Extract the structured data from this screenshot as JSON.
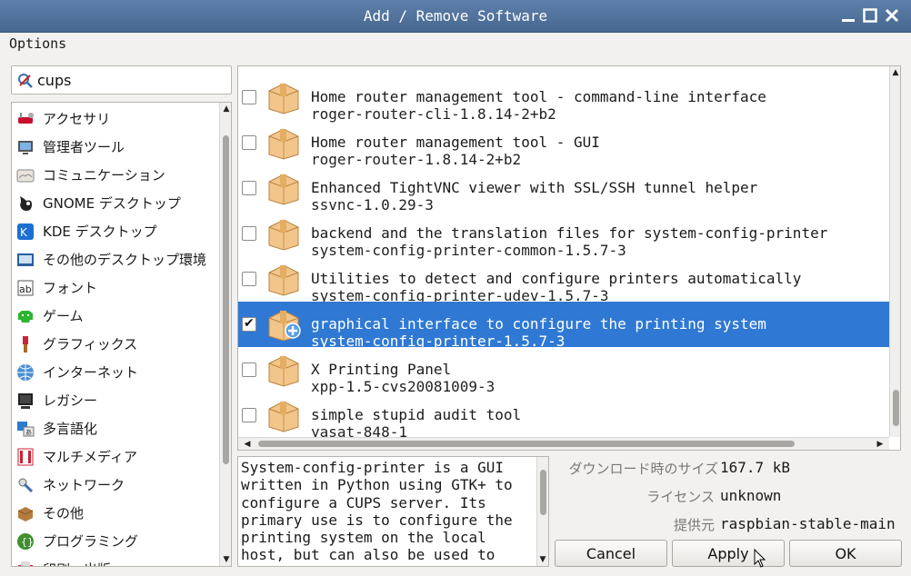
{
  "window": {
    "title": "Add / Remove Software"
  },
  "menu": {
    "options": "Options"
  },
  "search": {
    "value": "cups",
    "icon": "clear-search-icon"
  },
  "categories": [
    {
      "label": "アクセサリ",
      "icon": "accessories-icon"
    },
    {
      "label": "管理者ツール",
      "icon": "admin-tools-icon"
    },
    {
      "label": "コミュニケーション",
      "icon": "communication-icon"
    },
    {
      "label": "GNOME デスクトップ",
      "icon": "gnome-icon"
    },
    {
      "label": "KDE デスクトップ",
      "icon": "kde-icon"
    },
    {
      "label": "その他のデスクトップ環境",
      "icon": "other-desktop-icon"
    },
    {
      "label": "フォント",
      "icon": "font-icon"
    },
    {
      "label": "ゲーム",
      "icon": "game-icon"
    },
    {
      "label": "グラフィックス",
      "icon": "graphics-icon"
    },
    {
      "label": "インターネット",
      "icon": "internet-icon"
    },
    {
      "label": "レガシー",
      "icon": "legacy-icon"
    },
    {
      "label": "多言語化",
      "icon": "localization-icon"
    },
    {
      "label": "マルチメディア",
      "icon": "multimedia-icon"
    },
    {
      "label": "ネットワーク",
      "icon": "network-icon"
    },
    {
      "label": "その他",
      "icon": "other-icon"
    },
    {
      "label": "プログラミング",
      "icon": "programming-icon"
    },
    {
      "label": "印刷・出版",
      "icon": "publishing-icon"
    }
  ],
  "packages": [
    {
      "desc": "Home router management tool - command-line interface",
      "name": "roger-router-cli-1.8.14-2+b2",
      "checked": false,
      "selected": false
    },
    {
      "desc": "Home router management tool - GUI",
      "name": "roger-router-1.8.14-2+b2",
      "checked": false,
      "selected": false
    },
    {
      "desc": "Enhanced TightVNC viewer with SSL/SSH tunnel helper",
      "name": "ssvnc-1.0.29-3",
      "checked": false,
      "selected": false
    },
    {
      "desc": "backend and the translation files for system-config-printer",
      "name": "system-config-printer-common-1.5.7-3",
      "checked": false,
      "selected": false
    },
    {
      "desc": "Utilities to detect and configure printers automatically",
      "name": "system-config-printer-udev-1.5.7-3",
      "checked": false,
      "selected": false
    },
    {
      "desc": "graphical interface to configure the printing system",
      "name": "system-config-printer-1.5.7-3",
      "checked": true,
      "selected": true
    },
    {
      "desc": "X Printing Panel",
      "name": "xpp-1.5-cvs20081009-3",
      "checked": false,
      "selected": false
    },
    {
      "desc": "simple stupid audit tool",
      "name": "yasat-848-1",
      "checked": false,
      "selected": false
    }
  ],
  "details": {
    "description": "System-config-printer is a GUI\nwritten in Python using GTK+ to\nconfigure a CUPS server. Its\nprimary use is to configure the\nprinting system on the local\nhost, but can also be used to",
    "download_size_label": "ダウンロード時のサイズ",
    "download_size": "167.7 kB",
    "license_label": "ライセンス",
    "license": "unknown",
    "source_label": "提供元",
    "source": "raspbian-stable-main"
  },
  "buttons": {
    "cancel": "Cancel",
    "apply": "Apply",
    "ok": "OK"
  },
  "colors": {
    "titlebar": "#5576a0",
    "selection": "#2f79d4"
  }
}
